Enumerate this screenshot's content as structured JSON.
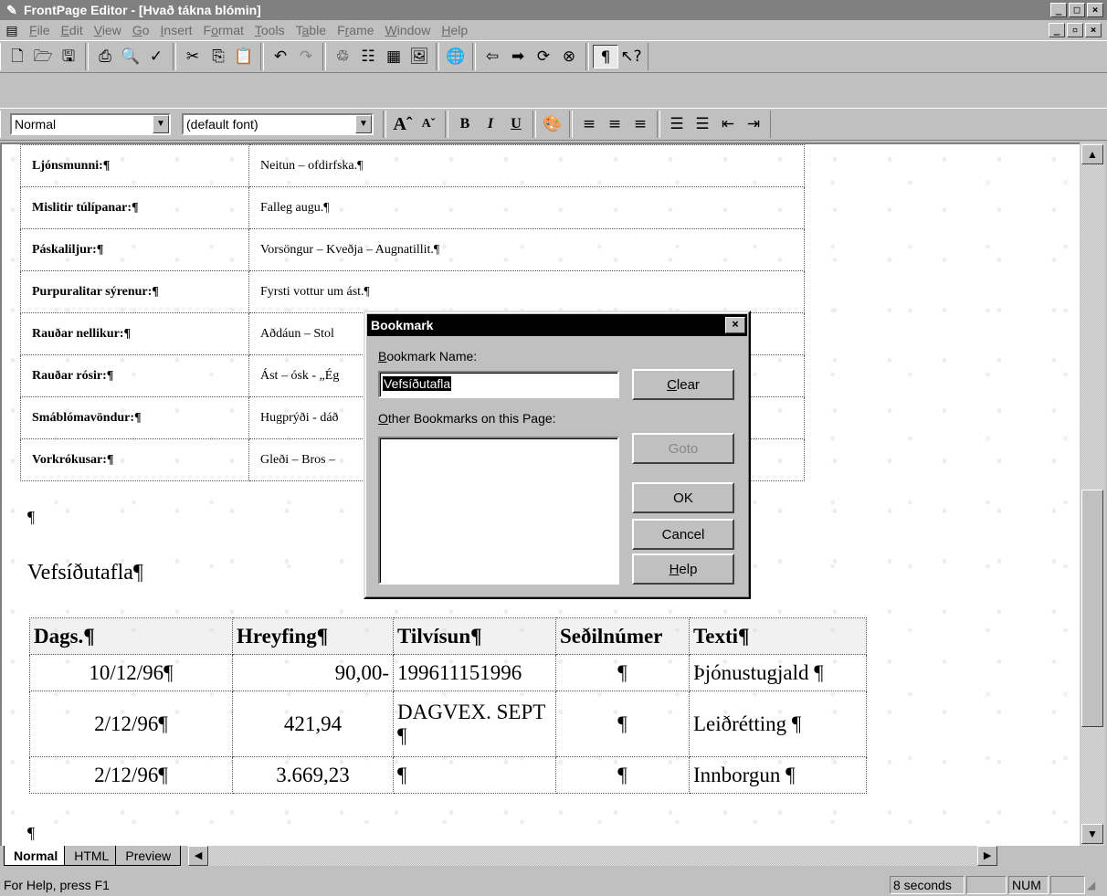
{
  "window": {
    "title": "FrontPage Editor - [Hvað tákna blómin]",
    "controls": [
      "_",
      "□",
      "×"
    ],
    "doc_controls": [
      "_",
      "▫",
      "×"
    ]
  },
  "menu": {
    "items": [
      {
        "u": "F",
        "rest": "ile"
      },
      {
        "u": "E",
        "rest": "dit"
      },
      {
        "u": "V",
        "rest": "iew"
      },
      {
        "u": "G",
        "rest": "o"
      },
      {
        "u": "I",
        "rest": "nsert"
      },
      {
        "pre": "F",
        "u": "o",
        "rest": "rmat"
      },
      {
        "u": "T",
        "rest": "ools"
      },
      {
        "pre": "T",
        "u": "a",
        "rest": "ble"
      },
      {
        "pre": "F",
        "u": "r",
        "rest": "ame"
      },
      {
        "u": "W",
        "rest": "indow"
      },
      {
        "u": "H",
        "rest": "elp"
      }
    ]
  },
  "format_toolbar": {
    "style": "Normal",
    "font": "(default font)"
  },
  "flower_table": [
    {
      "name": "Ljónsmunni:¶",
      "meaning": "Neitun – ofdirfska.¶"
    },
    {
      "name": "Mislitir túlípanar:¶",
      "meaning": "Falleg augu.¶"
    },
    {
      "name": "Páskaliljur:¶",
      "meaning": "Vorsöngur – Kveðja – Augnatillit.¶"
    },
    {
      "name": "Purpuralitar sýrenur:¶",
      "meaning": "Fyrsti vottur um ást.¶"
    },
    {
      "name": "Rauðar nellikur:¶",
      "meaning": "Aðdáun – Stol"
    },
    {
      "name": "Rauðar rósir:¶",
      "meaning": "Ást – ósk - „Ég"
    },
    {
      "name": "Smáblómavöndur:¶",
      "meaning": "Hugprýði - dáð"
    },
    {
      "name": "Vorkrókusar:¶",
      "meaning": "Gleði – Bros –"
    }
  ],
  "doc": {
    "empty_para": "¶",
    "heading": "Vefsíðutafla¶",
    "end_para": "¶"
  },
  "bank_table": {
    "headers": [
      "Dags.¶",
      "Hreyfing¶",
      "Tilvísun¶",
      "Seðilnúmer",
      "Texti¶"
    ],
    "rows": [
      [
        "10/12/96¶",
        "90,00-",
        "199611151996",
        "¶",
        "Þjónustugjald ¶"
      ],
      [
        "2/12/96¶",
        "421,94",
        "DAGVEX. SEPT ¶",
        "¶",
        "Leiðrétting ¶"
      ],
      [
        "2/12/96¶",
        "3.669,23",
        "¶",
        "¶",
        "Innborgun ¶"
      ]
    ]
  },
  "dialog": {
    "title": "Bookmark",
    "name_label_u": "B",
    "name_label_rest": "ookmark Name:",
    "name_value": "Vefsíðutafla",
    "other_label_u": "O",
    "other_label_rest": "ther Bookmarks on this Page:",
    "clear_u": "C",
    "clear_rest": "lear",
    "goto": "Goto",
    "ok": "OK",
    "cancel": "Cancel",
    "help_u": "H",
    "help_rest": "elp"
  },
  "tabs": [
    "Normal",
    "HTML",
    "Preview"
  ],
  "status": {
    "message": "For Help, press F1",
    "time": "8 seconds",
    "num": "NUM"
  }
}
